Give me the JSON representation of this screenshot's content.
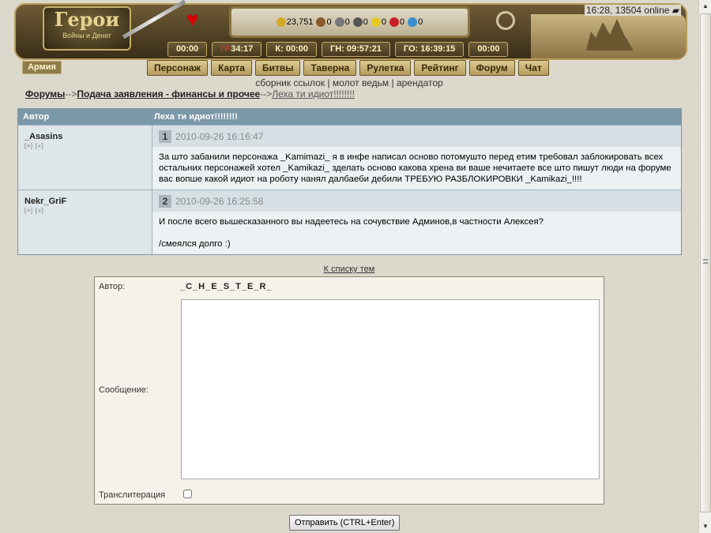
{
  "header": {
    "logo_title": "Герои",
    "logo_subtitle": "Войны и Денег",
    "status": "16:28, 13504 online",
    "resources": [
      {
        "icon": "gold-icon",
        "value": "23,751",
        "color": "#d4a92a"
      },
      {
        "icon": "wood-icon",
        "value": "0",
        "color": "#8a5a2b"
      },
      {
        "icon": "ore-icon",
        "value": "0",
        "color": "#777777"
      },
      {
        "icon": "mercury-icon",
        "value": "0",
        "color": "#555555"
      },
      {
        "icon": "sulfur-icon",
        "value": "0",
        "color": "#e6c822"
      },
      {
        "icon": "crystal-icon",
        "value": "0",
        "color": "#c8202a"
      },
      {
        "icon": "gem-icon",
        "value": "0",
        "color": "#3c8ed0"
      }
    ],
    "timers": [
      "00:00",
      "34:17",
      "К: 00:00",
      "ГН: 09:57:21",
      "ГО: 16:39:15",
      "00:00"
    ],
    "timer_flag": "ГР",
    "army_label": "Армия",
    "nav": [
      "Персонаж",
      "Карта",
      "Битвы",
      "Таверна",
      "Рулетка",
      "Рейтинг",
      "Форум",
      "Чат"
    ]
  },
  "sublinks": [
    "сборник ссылок",
    "молот ведьм",
    "арендатор"
  ],
  "breadcrumb": {
    "forums": "Форумы",
    "section": "Подача заявления - финансы и прочее",
    "topic": "Леха ти идиот!!!!!!!!",
    "sep": "-->"
  },
  "table": {
    "author_header": "Автор",
    "topic_header": "Леха ти идиот!!!!!!!!",
    "posts": [
      {
        "author": "_Asasins",
        "author_links": "[>] [«]",
        "num": "1",
        "date": "2010-09-26 16:16:47",
        "body": [
          "За што забанили персонажа _Kamimazi_ я в инфе написал осново потомушто перед етим требовал заблокировать всех остальних персонажей хотел _Kamikazi_ зделать осново какова хрена ви ваше нечитаете все што пишут люди на форуме вас вопше какой идиот на роботу нанял далбаеби дебили ТРЕБУЮ РАЗБЛОКИРОВКИ _Kamikazi_!!!!"
        ]
      },
      {
        "author": "Nekr_GriF",
        "author_links": "[>] [«]",
        "num": "2",
        "date": "2010-09-26 16:25:58",
        "body": [
          "И после всего вышесказанного вы надеетесь на сочувствие Админов,в частности Алексея?",
          "",
          "/смеялся долго :)"
        ]
      }
    ]
  },
  "back_link": "К списку тем",
  "reply": {
    "author_label": "Автор:",
    "author_value": "_C_H_E_S_T_E_R_",
    "message_label": "Сообщение:",
    "message_value": "",
    "translit_label": "Транслитерация",
    "submit_label": "Отправить (CTRL+Enter)"
  }
}
